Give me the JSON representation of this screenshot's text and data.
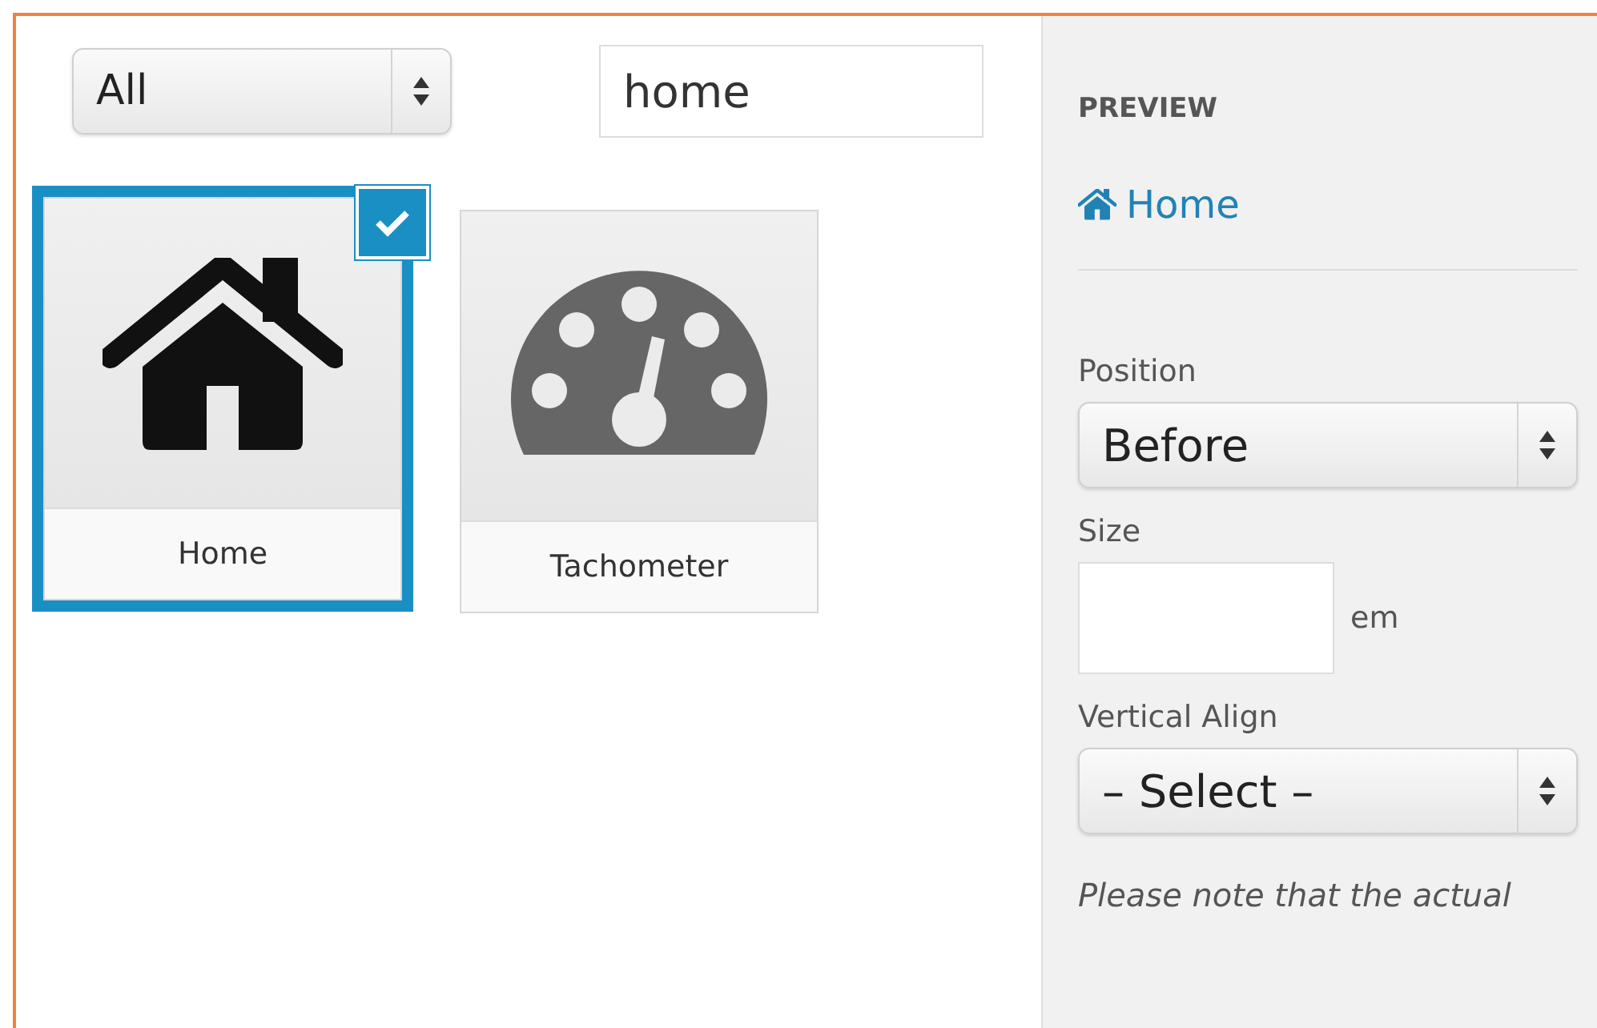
{
  "filter": {
    "value": "All"
  },
  "search": {
    "value": "home"
  },
  "icons": [
    {
      "label": "Home",
      "kind": "home",
      "selected": true
    },
    {
      "label": "Tachometer",
      "kind": "tachometer",
      "selected": false
    }
  ],
  "preview": {
    "heading": "PREVIEW",
    "link": "Home"
  },
  "fields": [
    {
      "kind": "select",
      "label": "Position",
      "value": "Before"
    },
    {
      "kind": "number",
      "label": "Size",
      "unit": "em"
    },
    {
      "kind": "select",
      "label": "Vertical Align",
      "value": "– Select –"
    }
  ],
  "note": "Please note that the actual"
}
